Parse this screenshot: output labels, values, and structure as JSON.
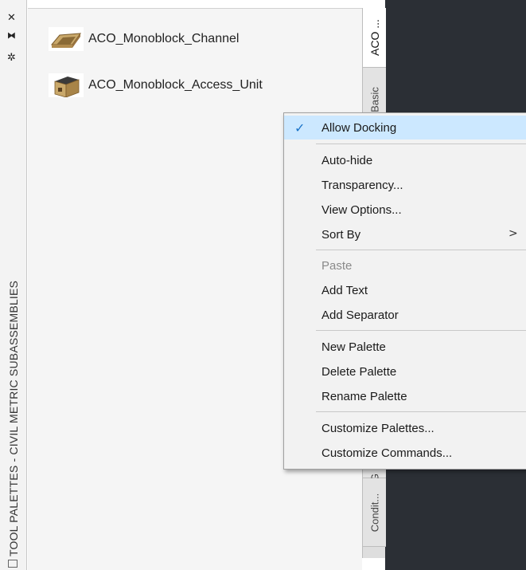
{
  "strip": {
    "title": "TOOL PALETTES - CIVIL METRIC SUBASSEMBLIES",
    "icons": [
      "close-icon",
      "pin-icon",
      "gear-icon",
      "properties-icon"
    ]
  },
  "palette": {
    "items": [
      {
        "label": "ACO_Monoblock_Channel",
        "icon": "channel-thumbnail"
      },
      {
        "label": "ACO_Monoblock_Access_Unit",
        "icon": "access-unit-thumbnail"
      }
    ]
  },
  "tabs": [
    {
      "label": "ACO ..."
    },
    {
      "label": "Basic"
    },
    {
      "label": "G"
    },
    {
      "label": "Condit..."
    }
  ],
  "context_menu": {
    "check_glyph": "✓",
    "submenu_glyph": ">",
    "items": [
      {
        "label": "Allow Docking",
        "checked": true
      },
      {
        "label": "Auto-hide"
      },
      {
        "label": "Transparency..."
      },
      {
        "label": "View Options..."
      },
      {
        "label": "Sort By",
        "submenu": true
      },
      {
        "label": "Paste",
        "disabled": true
      },
      {
        "label": "Add Text"
      },
      {
        "label": "Add Separator"
      },
      {
        "label": "New Palette"
      },
      {
        "label": "Delete Palette"
      },
      {
        "label": "Rename Palette"
      },
      {
        "label": "Customize Palettes..."
      },
      {
        "label": "Customize Commands..."
      }
    ]
  },
  "colors": {
    "highlight": "#cce8ff",
    "check": "#1a73c8",
    "background_dark": "#2b2f35"
  }
}
